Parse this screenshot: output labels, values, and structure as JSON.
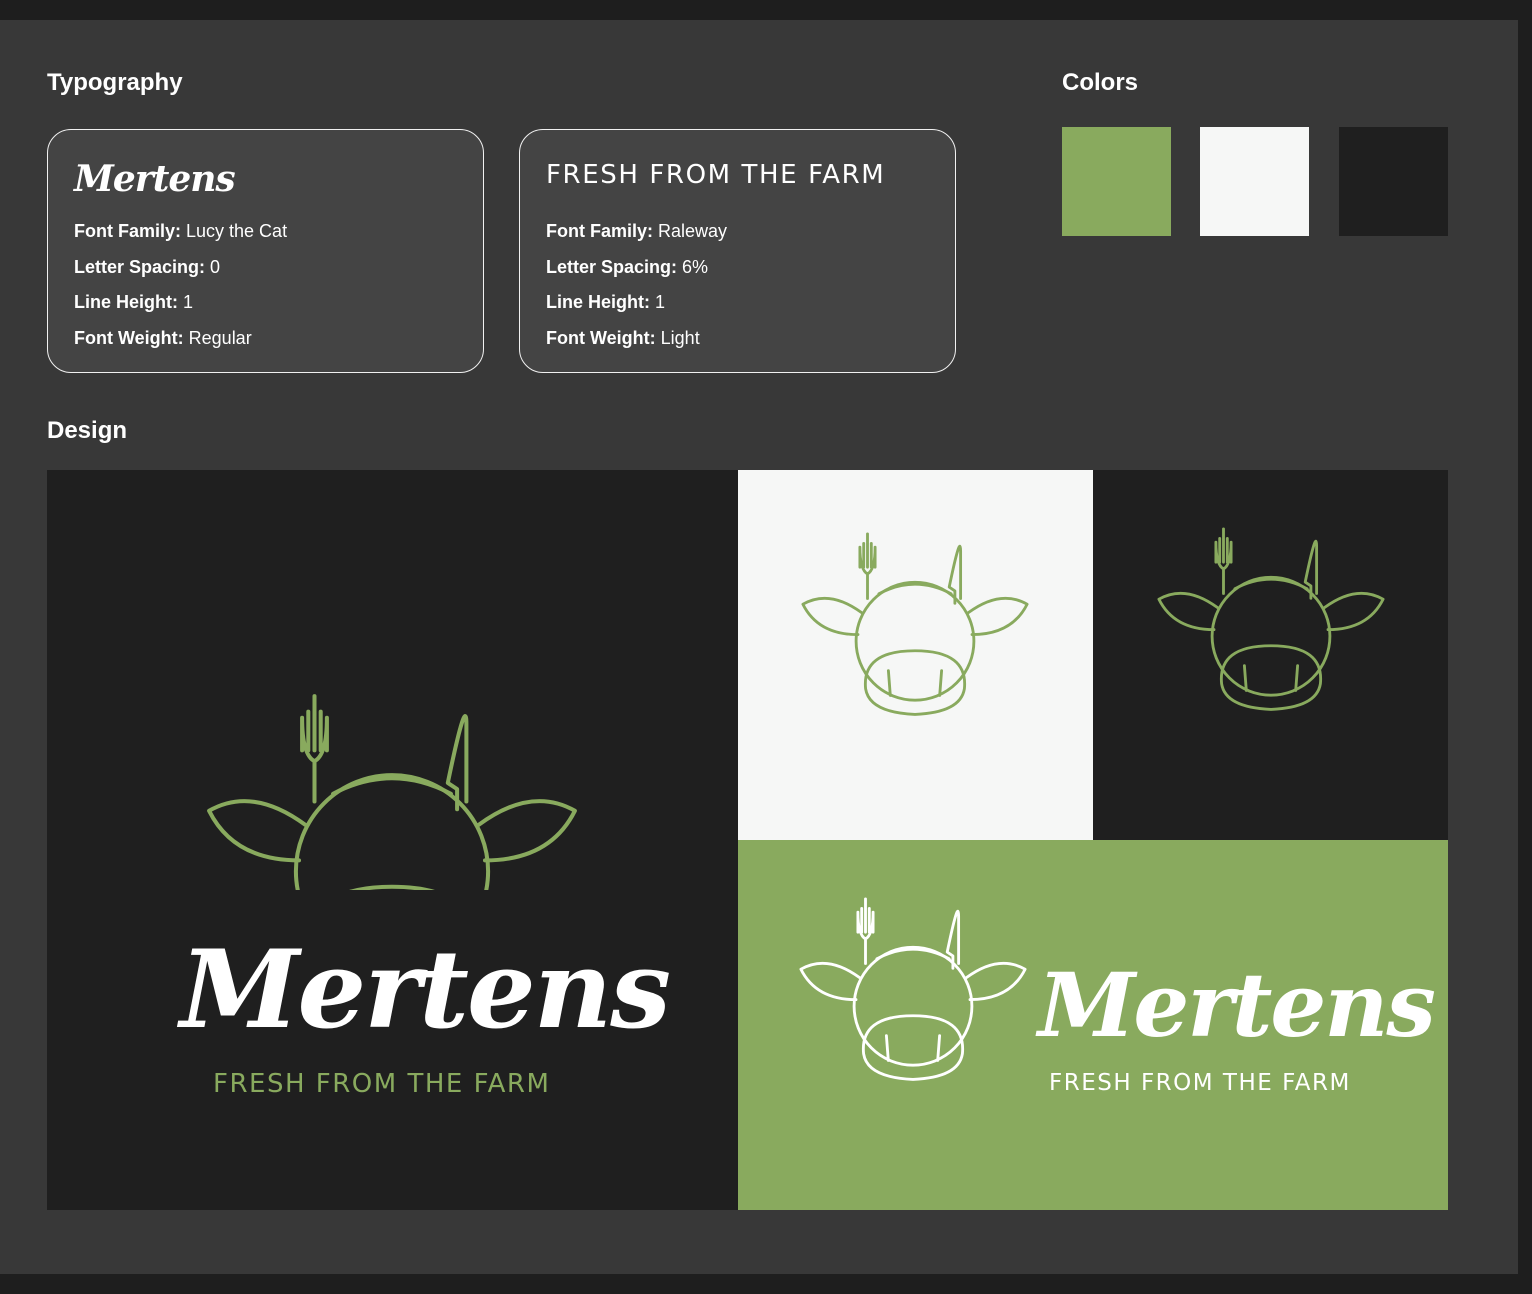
{
  "colors": {
    "accent_green": "#89aa5e",
    "off_white": "#f6f7f6",
    "dark": "#1f1f1f",
    "panel_bg": "#383838",
    "card_bg": "#444444"
  },
  "typography": {
    "title": "Typography",
    "cards": [
      {
        "sample": "Mertens",
        "specs": [
          {
            "key": "Font Family:",
            "value": "Lucy the Cat"
          },
          {
            "key": "Letter Spacing:",
            "value": "0"
          },
          {
            "key": "Line Height:",
            "value": "1"
          },
          {
            "key": "Font Weight:",
            "value": "Regular"
          }
        ]
      },
      {
        "sample": "FRESH FROM THE FARM",
        "specs": [
          {
            "key": "Font Family:",
            "value": "Raleway"
          },
          {
            "key": "Letter Spacing:",
            "value": "6%"
          },
          {
            "key": "Line Height:",
            "value": "1"
          },
          {
            "key": "Font Weight:",
            "value": "Light"
          }
        ]
      }
    ]
  },
  "colors_section": {
    "title": "Colors",
    "swatches": [
      "#89aa5e",
      "#f6f7f6",
      "#1f1f1f"
    ]
  },
  "design": {
    "title": "Design",
    "brand_name": "Mertens",
    "tagline": "FRESH FROM THE FARM",
    "logo_icon": "cow-fork-knife-icon"
  }
}
